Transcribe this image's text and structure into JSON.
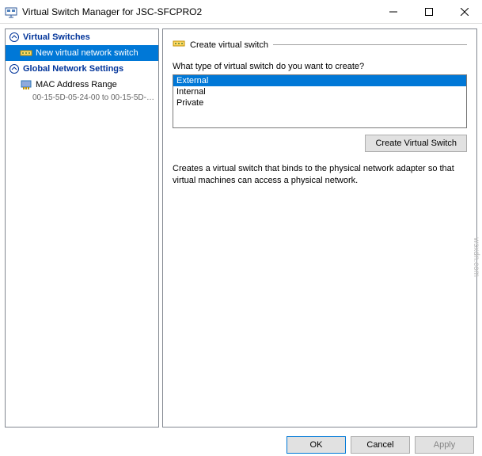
{
  "window": {
    "title": "Virtual Switch Manager for JSC-SFCPRO2"
  },
  "sidebar": {
    "sections": [
      {
        "title": "Virtual Switches",
        "items": [
          {
            "label": "New virtual network switch",
            "selected": true
          }
        ]
      },
      {
        "title": "Global Network Settings",
        "items": [
          {
            "label": "MAC Address Range",
            "sub": "00-15-5D-05-24-00 to 00-15-5D-0..."
          }
        ]
      }
    ]
  },
  "main": {
    "group_title": "Create virtual switch",
    "question": "What type of virtual switch do you want to create?",
    "options": [
      "External",
      "Internal",
      "Private"
    ],
    "selected_option": "External",
    "create_button": "Create Virtual Switch",
    "description": "Creates a virtual switch that binds to the physical network adapter so that virtual machines can access a physical network."
  },
  "footer": {
    "ok": "OK",
    "cancel": "Cancel",
    "apply": "Apply"
  },
  "watermark": "wsxdn.com"
}
